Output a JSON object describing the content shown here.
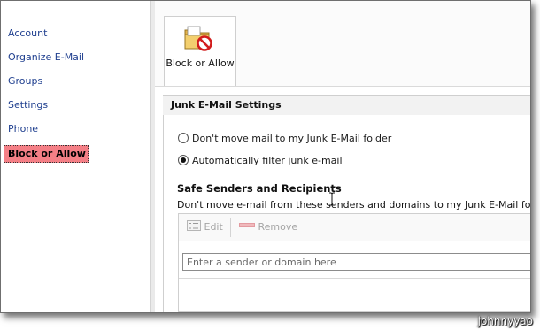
{
  "sidebar": {
    "items": [
      {
        "label": "Account"
      },
      {
        "label": "Organize E-Mail"
      },
      {
        "label": "Groups"
      },
      {
        "label": "Settings"
      },
      {
        "label": "Phone"
      },
      {
        "label": "Block or Allow",
        "active": true
      }
    ]
  },
  "ribbon": {
    "button_label": "Block or Allow",
    "button_icon": "folder-block-icon"
  },
  "junk_settings": {
    "header": "Junk E-Mail Settings",
    "options": [
      {
        "label": "Don't move mail to my Junk E-Mail folder",
        "checked": false
      },
      {
        "label": "Automatically filter junk e-mail",
        "checked": true
      }
    ]
  },
  "safe_senders": {
    "title": "Safe Senders and Recipients",
    "description": "Don't move e-mail from these senders and domains to my Junk E-Mail folder",
    "edit_label": "Edit",
    "remove_label": "Remove",
    "input_placeholder": "Enter a sender or domain here",
    "input_value": ""
  },
  "watermark": "johnnyyao",
  "colors": {
    "active_item_bg": "#f47f86",
    "nav_link": "#1f3f8f",
    "disabled_text": "#a5a5a5"
  }
}
